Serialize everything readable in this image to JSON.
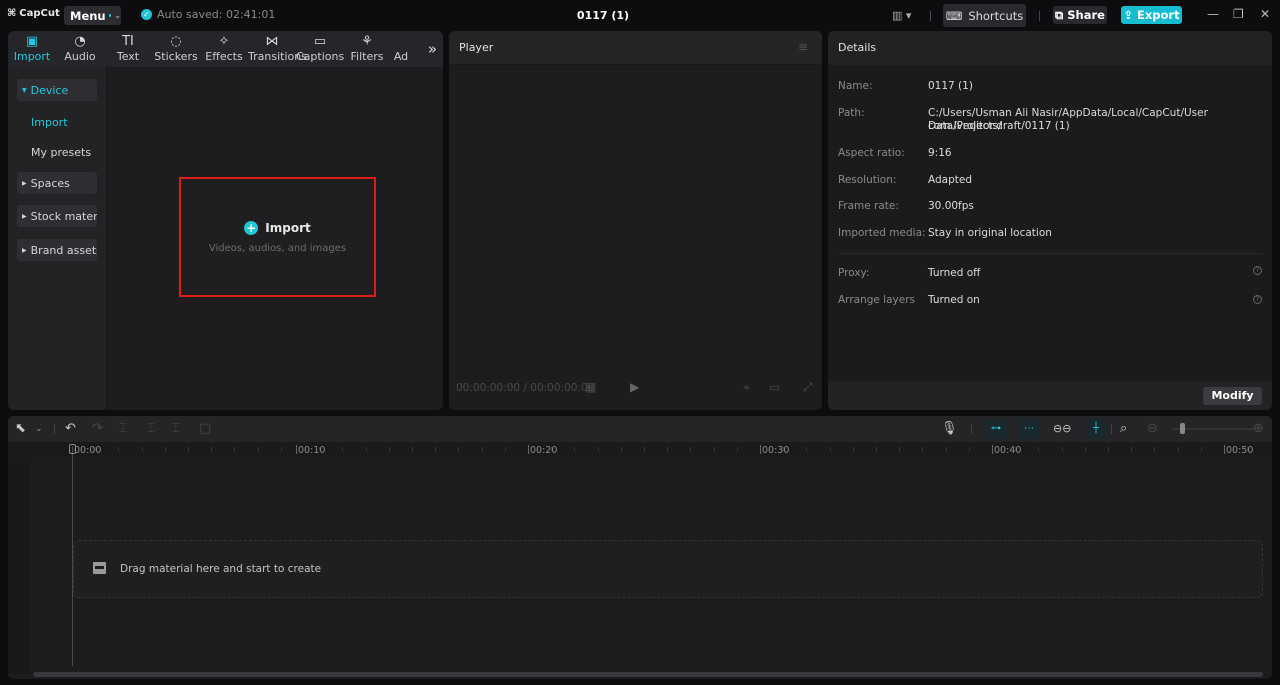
{
  "app": {
    "logo": "CapCut",
    "menu_label": "Menu",
    "autosave": "Auto saved: 02:41:01",
    "project_title": "0117 (1)"
  },
  "titlebar": {
    "shortcuts": "Shortcuts",
    "share": "Share",
    "export": "Export",
    "accent": "#16bccf"
  },
  "tabs": [
    {
      "label": "Import",
      "icon": "▣",
      "active": true
    },
    {
      "label": "Audio",
      "icon": "◔"
    },
    {
      "label": "Text",
      "icon": "TI"
    },
    {
      "label": "Stickers",
      "icon": "◌"
    },
    {
      "label": "Effects",
      "icon": "✧"
    },
    {
      "label": "Transitions",
      "icon": "⋈"
    },
    {
      "label": "Captions",
      "icon": "▭"
    },
    {
      "label": "Filters",
      "icon": "⚘"
    },
    {
      "label": "Ad",
      "icon": ""
    }
  ],
  "more_tabs": "»",
  "sidebar": {
    "device": "Device",
    "import": "Import",
    "my_presets": "My presets",
    "spaces": "Spaces",
    "stock": "Stock mater...",
    "brand": "Brand assets"
  },
  "import_box": {
    "label": "Import",
    "sub": "Videos, audios, and images"
  },
  "player": {
    "title": "Player",
    "time": "00:00:00:00 / 00:00:00:00"
  },
  "details": {
    "title": "Details",
    "rows": [
      {
        "label": "Name:",
        "value": "0117 (1)"
      },
      {
        "label": "Path:",
        "value": "C:/Users/Usman Ali Nasir/AppData/Local/CapCut/User Data/Projects/",
        "value2": "com.lveditor.draft/0117 (1)"
      },
      {
        "label": "Aspect ratio:",
        "value": "9:16"
      },
      {
        "label": "Resolution:",
        "value": "Adapted"
      },
      {
        "label": "Frame rate:",
        "value": "30.00fps"
      },
      {
        "label": "Imported media:",
        "value": "Stay in original location"
      },
      {
        "label": "Proxy:",
        "value": "Turned off"
      },
      {
        "label": "Arrange layers",
        "value": "Turned on"
      }
    ],
    "modify": "Modify"
  },
  "timeline": {
    "ruler": [
      "00:00",
      "00:10",
      "00:20",
      "00:30",
      "00:40",
      "00:50"
    ],
    "drop_text": "Drag material here and start to create"
  }
}
